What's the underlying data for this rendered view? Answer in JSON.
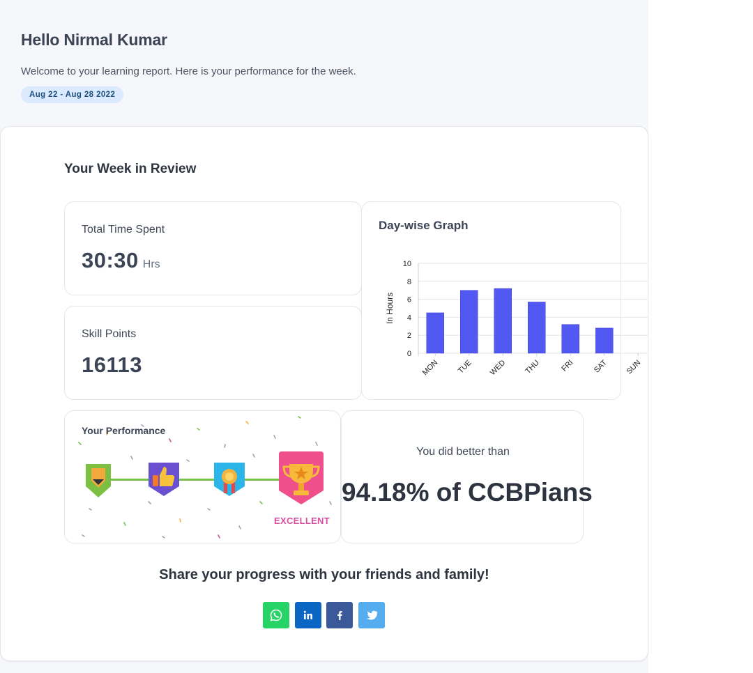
{
  "header": {
    "greeting": "Hello Nirmal Kumar",
    "welcome": "Welcome to your learning report. Here is your performance for the week.",
    "date_range": "Aug 22 - Aug 28 2022"
  },
  "review": {
    "title": "Your Week in Review",
    "time_spent": {
      "label": "Total Time Spent",
      "value": "30:30",
      "unit": "Hrs"
    },
    "skill_points": {
      "label": "Skill Points",
      "value": "16113"
    },
    "graph_title": "Day-wise Graph",
    "performance": {
      "title": "Your Performance",
      "levels": [
        "pencil-badge-icon",
        "thumbs-up-badge-icon",
        "medal-badge-icon",
        "trophy-badge-icon"
      ],
      "current_level": "EXCELLENT"
    },
    "comparison": {
      "label": "You did better than",
      "value": "94.18% of CCBPians"
    }
  },
  "share": {
    "title": "Share your progress with your friends and family!",
    "buttons": [
      {
        "name": "whatsapp",
        "icon": "whatsapp-icon",
        "color": "#25d366"
      },
      {
        "name": "linkedin",
        "icon": "linkedin-icon",
        "color": "#0a66c2"
      },
      {
        "name": "facebook",
        "icon": "facebook-icon",
        "color": "#3b5998"
      },
      {
        "name": "twitter",
        "icon": "twitter-icon",
        "color": "#55acee"
      }
    ]
  },
  "chart_data": {
    "type": "bar",
    "title": "Day-wise Graph",
    "xlabel": "",
    "ylabel": "In Hours",
    "categories": [
      "MON",
      "TUE",
      "WED",
      "THU",
      "FRI",
      "SAT",
      "SUN"
    ],
    "values": [
      4.5,
      7.0,
      7.2,
      5.7,
      3.2,
      2.8,
      0
    ],
    "ylim": [
      0,
      10
    ],
    "yticks": [
      0,
      2,
      4,
      6,
      8,
      10
    ],
    "grid": true,
    "bar_color": "#5258f2"
  }
}
